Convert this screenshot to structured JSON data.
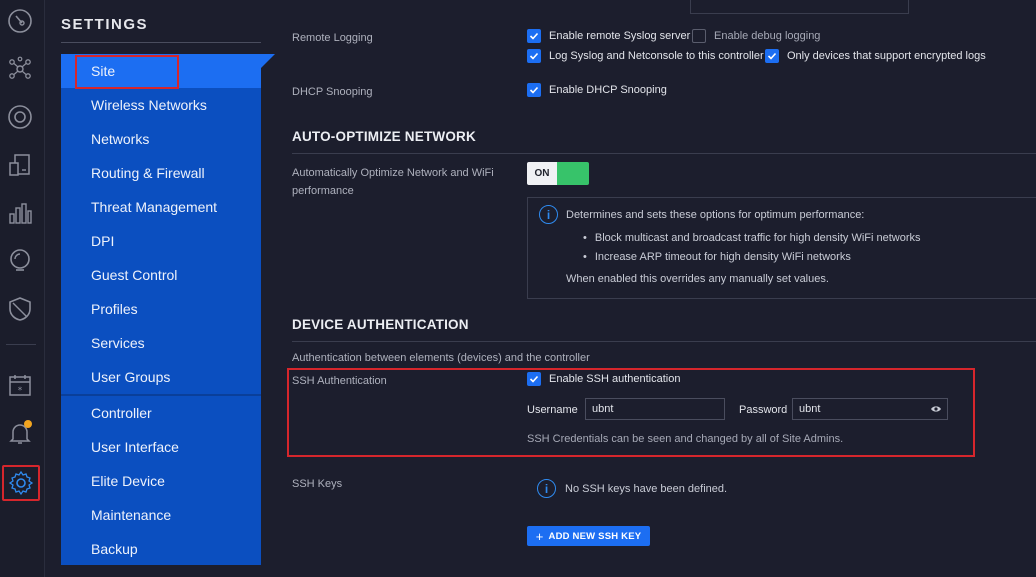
{
  "colors": {
    "accent": "#1c6ef2",
    "menu_bg": "#0b4fc0",
    "highlight": "#d6262c",
    "toggle_on": "#37c36a",
    "notification": "#f2a520"
  },
  "rail": {
    "icons": [
      "dashboard-icon",
      "topology-icon",
      "devices-icon",
      "clients-icon",
      "statistics-icon",
      "insights-icon",
      "security-icon",
      "calendar-icon",
      "alerts-icon",
      "settings-icon"
    ]
  },
  "settings": {
    "title": "SETTINGS",
    "menu": [
      "Site",
      "Wireless Networks",
      "Networks",
      "Routing & Firewall",
      "Threat Management",
      "DPI",
      "Guest Control",
      "Profiles",
      "Services",
      "User Groups",
      "Controller",
      "User Interface",
      "Elite Device",
      "Maintenance",
      "Backup"
    ]
  },
  "remote_logging": {
    "label": "Remote Logging",
    "enable_syslog": "Enable remote Syslog server",
    "enable_syslog_checked": true,
    "enable_debug": "Enable debug logging",
    "enable_debug_checked": false,
    "log_syslog_netconsole": "Log Syslog and Netconsole to this controller",
    "log_syslog_netconsole_checked": true,
    "only_encrypted": "Only devices that support encrypted logs",
    "only_encrypted_checked": true
  },
  "dhcp": {
    "label": "DHCP Snooping",
    "enable": "Enable DHCP Snooping",
    "checked": true
  },
  "auto_optimize": {
    "title": "AUTO-OPTIMIZE NETWORK",
    "label_line1": "Automatically Optimize Network and WiFi",
    "label_line2": "performance",
    "toggle": "ON",
    "info_intro": "Determines and sets these options for optimum performance:",
    "bullets": [
      "Block multicast and broadcast traffic for high density WiFi networks",
      "Increase ARP timeout for high density WiFi networks"
    ],
    "info_outro": "When enabled this overrides any manually set values."
  },
  "device_auth": {
    "title": "DEVICE AUTHENTICATION",
    "subtitle": "Authentication between elements (devices) and the controller",
    "ssh_label": "SSH Authentication",
    "enable_ssh": "Enable SSH authentication",
    "enable_ssh_checked": true,
    "username_label": "Username",
    "username_value": "ubnt",
    "password_label": "Password",
    "password_value": "ubnt",
    "note": "SSH Credentials can be seen and changed by all of Site Admins.",
    "ssh_keys_label": "SSH Keys",
    "no_keys": "No SSH keys have been defined.",
    "add_key_button": "ADD NEW SSH KEY"
  }
}
